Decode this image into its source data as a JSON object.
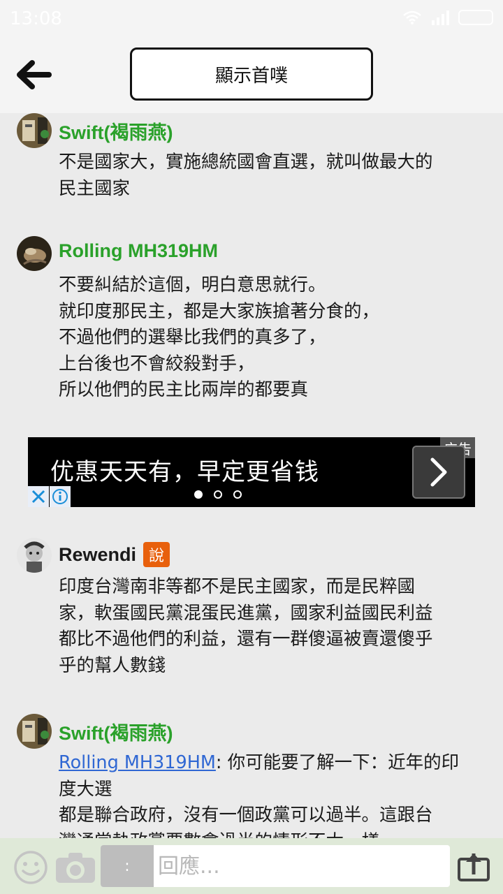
{
  "status_bar": {
    "time": "13:08"
  },
  "header": {
    "title": "顯示首噗"
  },
  "comments": [
    {
      "author": "Swift(褐雨燕)",
      "lines": [
        "不是國家大，實施總統國會直選，就叫做最大的",
        "民主國家"
      ]
    },
    {
      "author": "Rolling MH319HM",
      "lines": [
        "不要糾結於這個，明白意思就行。",
        "就印度那民主，都是大家族搶著分食的，",
        "不過他們的選舉比我們的真多了，",
        "上台後也不會絞殺對手，",
        "所以他們的民主比兩岸的都要真"
      ]
    },
    {
      "author": "Rewendi",
      "badge": "說",
      "lines": [
        "印度台灣南非等都不是民主國家，而是民粹國",
        "家，軟蛋國民黨混蛋民進黨，國家利益國民利益",
        "都比不過他們的利益，還有一群傻逼被賣還傻乎",
        "乎的幫人數錢"
      ]
    },
    {
      "author": "Swift(褐雨燕)",
      "mention": "Rolling MH319HM",
      "first_line_rest": ": 你可能要了解一下：近年的印",
      "lines": [
        "度大選",
        "都是聯合政府，沒有一個政黨可以過半。這跟台",
        "灣通常執政黨要數會過半的情形不太一樣"
      ]
    }
  ],
  "ad": {
    "text": "优惠天天有，早定更省钱",
    "tag": "广告",
    "dots_total": 3,
    "dot_active": 1
  },
  "reply": {
    "prefix": ":",
    "placeholder": "回應..."
  },
  "colors": {
    "author_green": "#2aa12a",
    "link_blue": "#2f67d3",
    "badge_orange": "#e8600c"
  }
}
